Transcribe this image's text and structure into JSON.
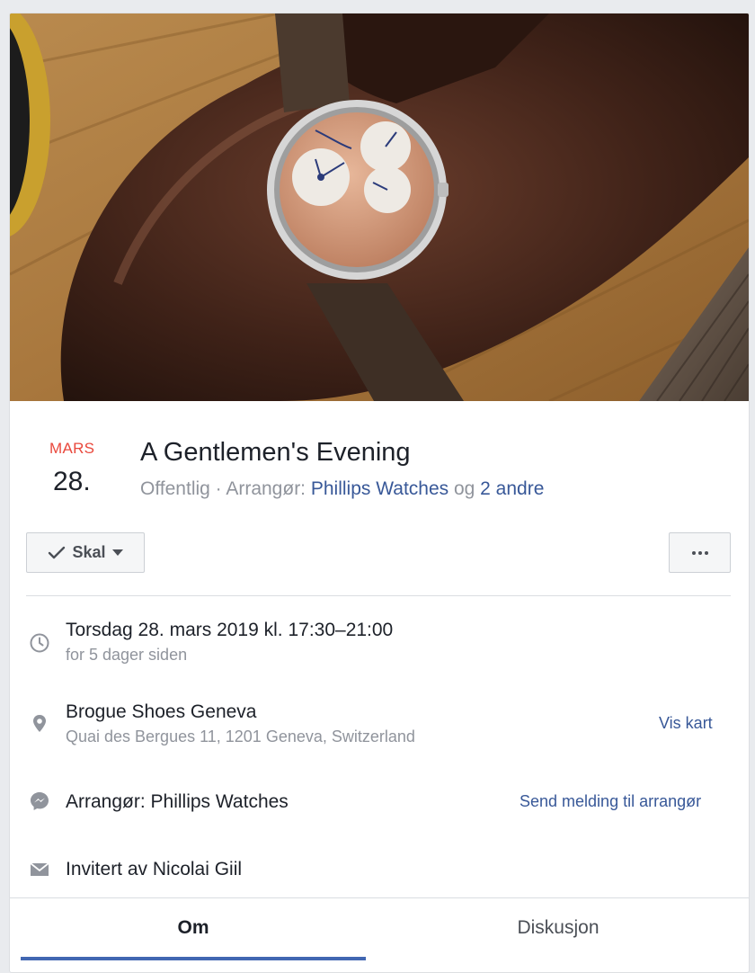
{
  "event": {
    "month": "MARS",
    "day": "28.",
    "title": "A Gentlemen's Evening",
    "visibility": "Offentlig · Arrangør: ",
    "organizer_link": "Phillips Watches",
    "og": " og ",
    "others_link": "2 andre"
  },
  "actions": {
    "going_label": "Skal",
    "more_icon": "more-horizontal-icon"
  },
  "details": {
    "time": {
      "icon": "clock-icon",
      "title": "Torsdag 28. mars 2019 kl. 17:30–21:00",
      "sub": "for 5 dager siden"
    },
    "location": {
      "icon": "location-pin-icon",
      "title": "Brogue Shoes Geneva",
      "sub": "Quai des Bergues 11, 1201 Geneva, Switzerland",
      "action": "Vis kart"
    },
    "organizer": {
      "icon": "messenger-icon",
      "title": "Arrangør: Phillips Watches",
      "action": "Send melding til arrangør"
    },
    "invite": {
      "icon": "envelope-icon",
      "title": "Invitert av Nicolai Giil"
    }
  },
  "tabs": [
    {
      "label": "Om",
      "active": true
    },
    {
      "label": "Diskusjon",
      "active": false
    }
  ],
  "colors": {
    "link": "#385898",
    "month": "#e9483c",
    "tab_active": "#4267b2",
    "muted": "#90949c"
  }
}
